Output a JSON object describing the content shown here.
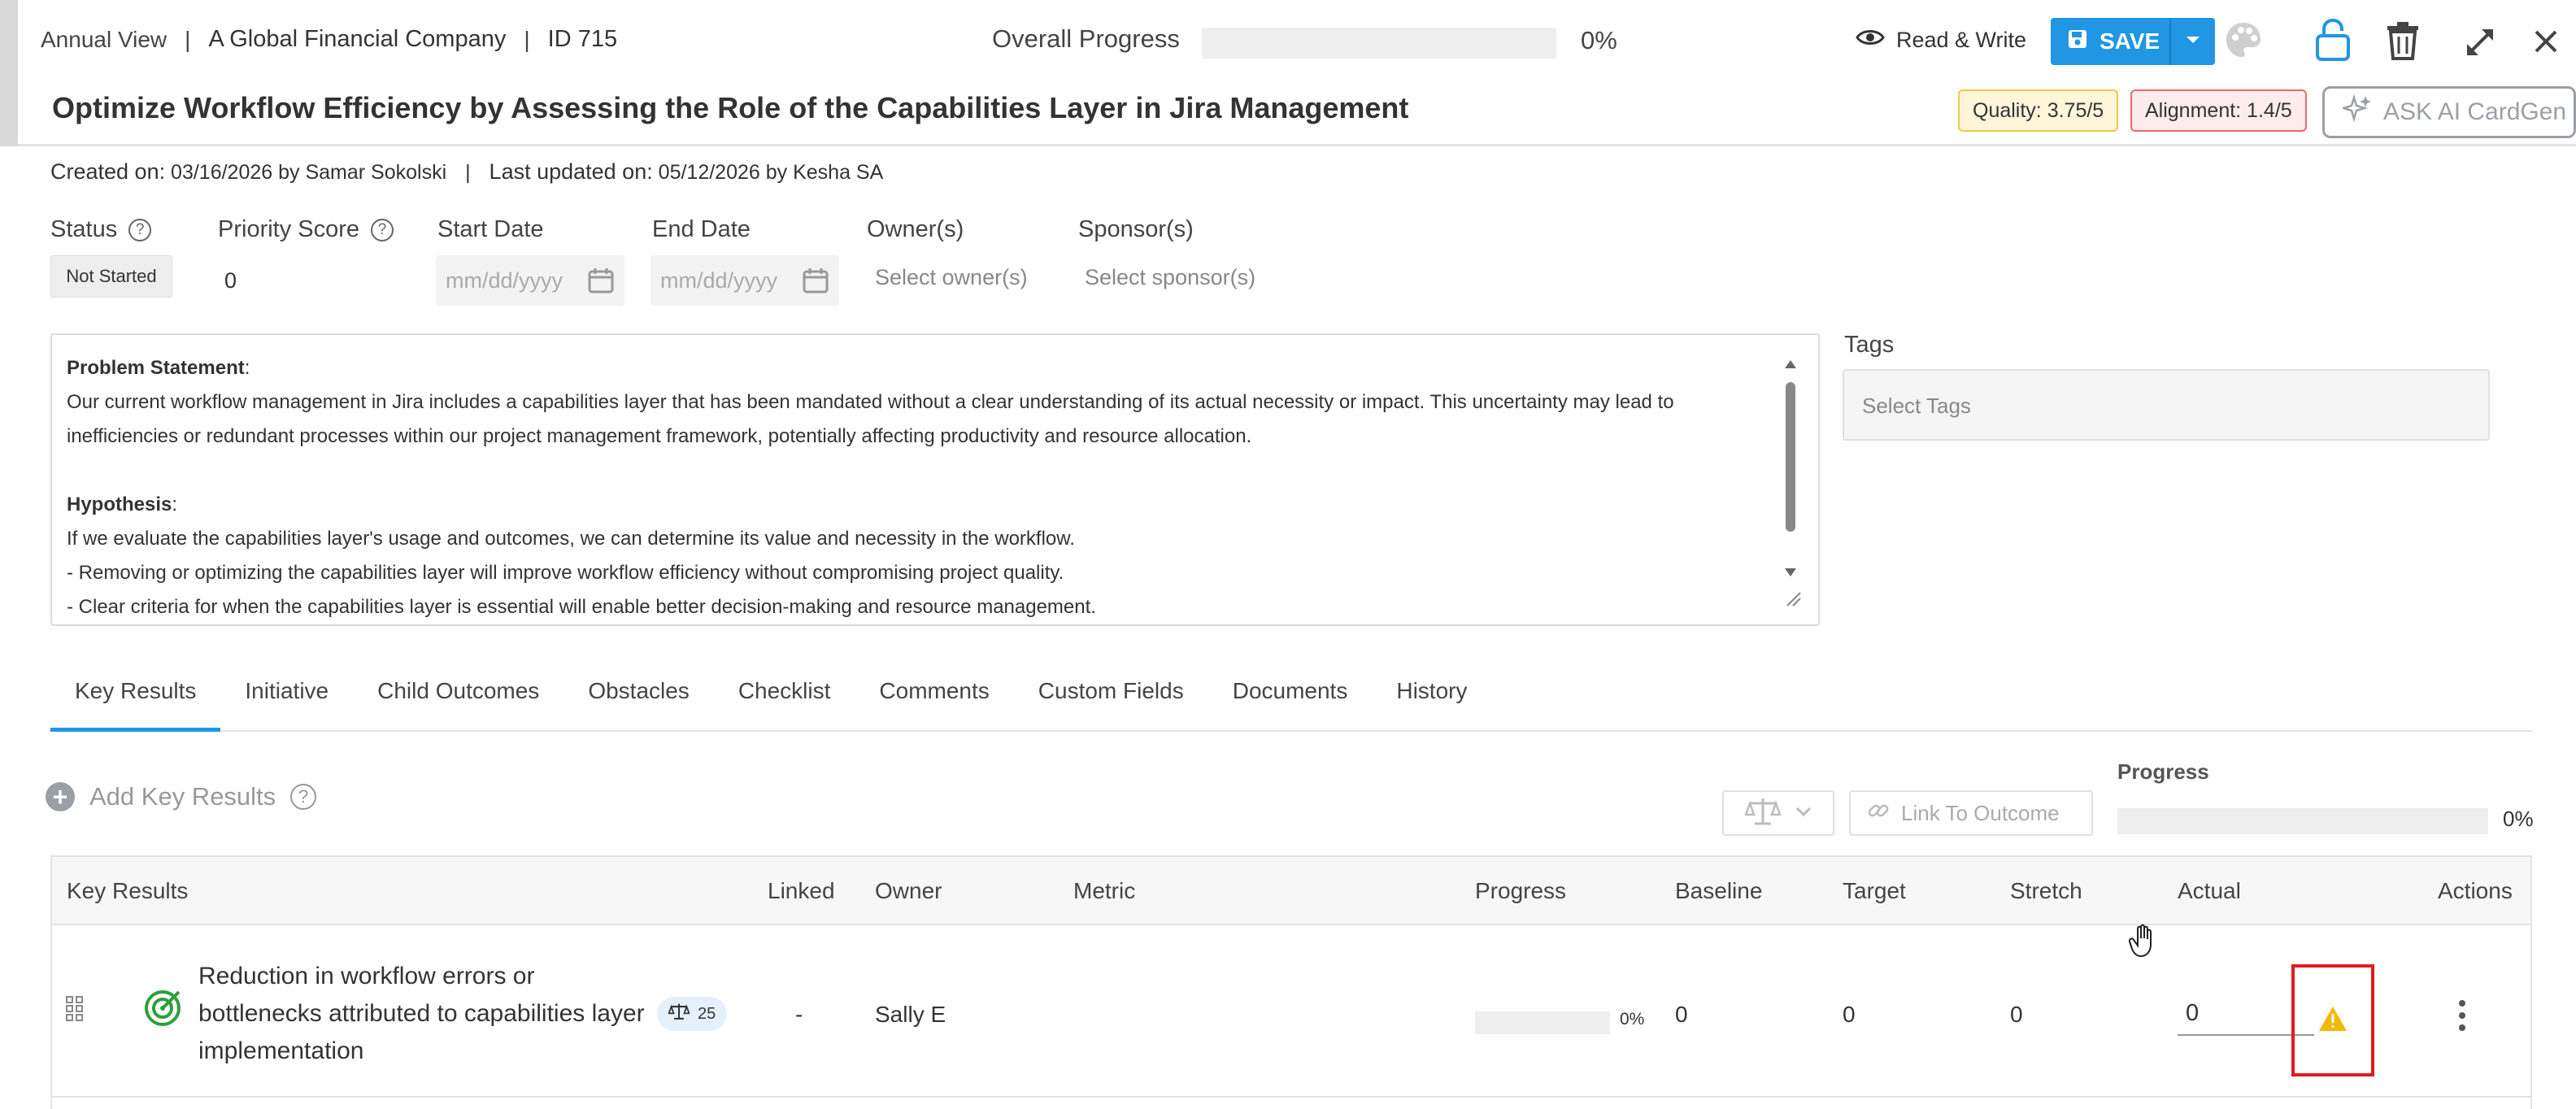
{
  "header": {
    "view": "Annual View",
    "company": "A Global Financial Company",
    "id_label": "ID 715",
    "overall_progress_label": "Overall Progress",
    "overall_progress_value": "0%",
    "overall_progress_fraction": 0,
    "read_write_label": "Read & Write",
    "save_label": "SAVE",
    "title": "Optimize Workflow Efficiency by Assessing the Role of the Capabilities Layer in Jira Management",
    "quality_badge": "Quality: 3.75/5",
    "alignment_badge": "Alignment: 1.4/5",
    "ask_ai_label": "ASK AI CardGen",
    "icons": [
      "eye-icon",
      "save-icon",
      "chevron-down-icon",
      "palette-icon",
      "lock-icon",
      "trash-icon",
      "expand-icon",
      "close-icon",
      "sparkle-icon"
    ]
  },
  "meta": {
    "created_label": "Created on:",
    "created_value": "03/16/2026 by Samar Sokolski",
    "updated_label": "Last updated on:",
    "updated_value": "05/12/2026 by Kesha SA"
  },
  "fields": {
    "status_label": "Status",
    "status_value": "Not Started",
    "priority_label": "Priority Score",
    "priority_value": "0",
    "start_label": "Start Date",
    "start_placeholder": "mm/dd/yyyy",
    "end_label": "End Date",
    "end_placeholder": "mm/dd/yyyy",
    "owner_label": "Owner(s)",
    "owner_placeholder": "Select owner(s)",
    "sponsor_label": "Sponsor(s)",
    "sponsor_placeholder": "Select sponsor(s)"
  },
  "description": {
    "problem_heading": "Problem Statement",
    "problem_text": "Our current workflow management in Jira includes a capabilities layer that has been mandated without a clear understanding of its actual necessity or impact. This uncertainty may lead to inefficiencies or redundant processes within our project management framework, potentially affecting productivity and resource allocation.",
    "hypothesis_heading": "Hypothesis",
    "hypothesis_lines": [
      "If we evaluate the capabilities layer's usage and outcomes, we can determine its value and necessity in the workflow.",
      "- Removing or optimizing the capabilities layer will improve workflow efficiency without compromising project quality.",
      "- Clear criteria for when the capabilities layer is essential will enable better decision-making and resource management."
    ]
  },
  "tags": {
    "label": "Tags",
    "placeholder": "Select Tags"
  },
  "tabs": [
    {
      "label": "Key Results",
      "active": true
    },
    {
      "label": "Initiative"
    },
    {
      "label": "Child Outcomes"
    },
    {
      "label": "Obstacles"
    },
    {
      "label": "Checklist"
    },
    {
      "label": "Comments"
    },
    {
      "label": "Custom Fields"
    },
    {
      "label": "Documents"
    },
    {
      "label": "History"
    }
  ],
  "key_results_panel": {
    "add_label": "Add Key Results",
    "link_label": "Link To Outcome",
    "progress_label": "Progress",
    "progress_value": "0%",
    "progress_fraction": 0
  },
  "table": {
    "columns": [
      "Key Results",
      "Linked",
      "Owner",
      "Metric",
      "Progress",
      "Baseline",
      "Target",
      "Stretch",
      "Actual",
      "Actions"
    ],
    "rows": [
      {
        "name": "Reduction in workflow errors or bottlenecks attributed to capabilities layer implementation",
        "weight": "25",
        "linked": "-",
        "owner": "Sally E",
        "metric": "",
        "progress": "0%",
        "progress_fraction": 0,
        "baseline": "0",
        "target": "0",
        "stretch": "0",
        "actual": "0"
      }
    ]
  },
  "colors": {
    "accent": "#2196e3",
    "warning": "#f5b800",
    "highlight_border": "#e01b1b",
    "kr_icon": "#2e9e3e"
  }
}
